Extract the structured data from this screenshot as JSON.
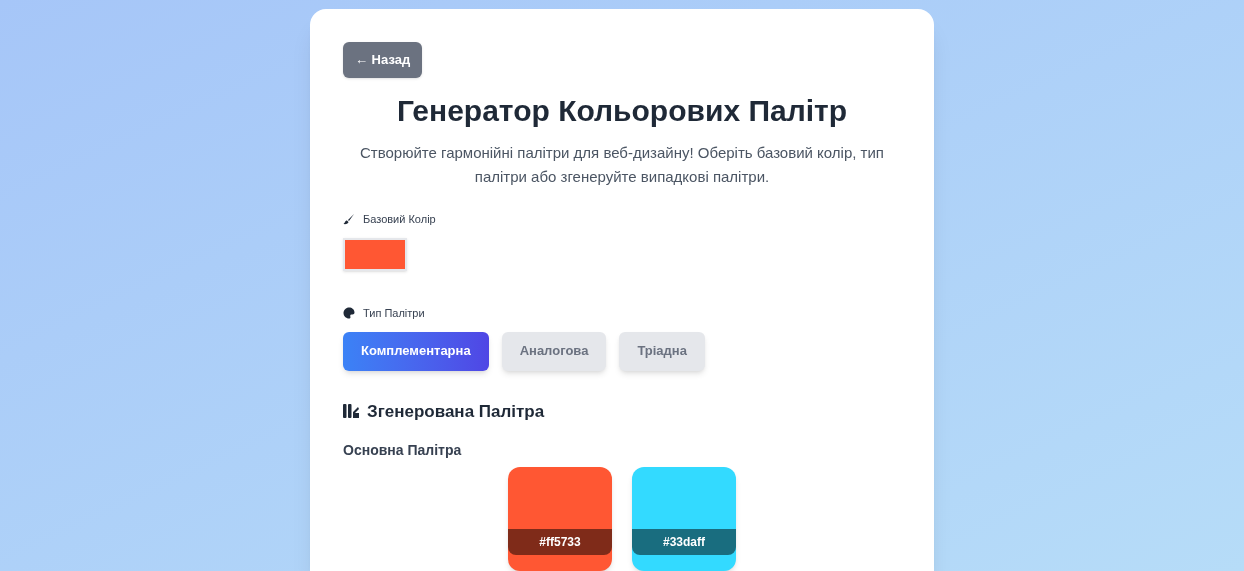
{
  "back_button": {
    "label": "← Назад"
  },
  "title": "Генератор Кольорових Палітр",
  "description": "Створюйте гармонійні палітри для веб-дизайну! Оберіть базовий колір, тип палітри або згенеруйте випадкові палітри.",
  "base_color": {
    "label": "Базовий Колір",
    "color": "#ff5733"
  },
  "palette_type": {
    "label": "Тип Палітри",
    "options": [
      {
        "label": "Комплементарна",
        "selected": true
      },
      {
        "label": "Аналогова",
        "selected": false
      },
      {
        "label": "Тріадна",
        "selected": false
      }
    ]
  },
  "generated": {
    "heading": "Згенерована Палітра",
    "subheading": "Основна Палітра",
    "swatches": [
      {
        "hex": "#ff5733",
        "color": "#ff5733"
      },
      {
        "hex": "#33daff",
        "color": "#33daff"
      }
    ]
  }
}
